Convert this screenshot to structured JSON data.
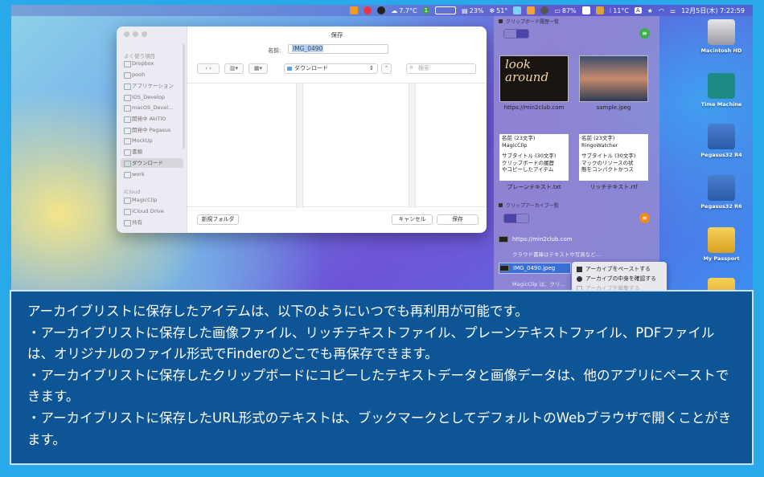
{
  "menubar": {
    "weather": "7.7°C",
    "badge_number": "1",
    "cpu_percent": "23%",
    "fan": "51°",
    "battery": "87%",
    "temp": "11°C",
    "input_mode": "A",
    "clock": "12月5日(木) 7:22:59"
  },
  "dialog": {
    "title": "保存",
    "name_label": "名前:",
    "name_value": "IMG_0490",
    "location": "ダウンロード",
    "search_placeholder": "検索",
    "new_folder": "新規フォルダ",
    "cancel": "キャンセル",
    "save": "保存",
    "sidebar": {
      "favorites_title": "よく使う項目",
      "favorites": [
        "Dropbox",
        "pooh",
        "アプリケーション",
        "iOS_Develop",
        "macOS_Devel...",
        "開発中 AkiTiO",
        "開発中 Pegasus",
        "MockUp",
        "書類",
        "ダウンロード",
        "work"
      ],
      "icloud_title": "iCloud",
      "icloud": [
        "MagicClip",
        "iCloud Drive",
        "共有"
      ]
    }
  },
  "panel": {
    "history_title": "クリップボード履歴一覧",
    "items": [
      {
        "caption": "https://min2club.com",
        "thumb_text": "look around"
      },
      {
        "caption": "sample.jpeg"
      }
    ],
    "text_cards": [
      {
        "caption": "プレーンテキスト.txt",
        "lines": [
          "名前 (23文字)",
          "MagicClip",
          "",
          "サブタイトル (30文字)",
          "クリップボードの履歴",
          "やコピーしたアイテム"
        ]
      },
      {
        "caption": "リッチテキスト.rtf",
        "lines": [
          "名前 (23文字)",
          "RingoWatcher",
          "",
          "サブタイトル (30文字)",
          "マックのリソースの状",
          "態をコンパクトかつス"
        ]
      }
    ],
    "archive_title": "クリップアーカイブ一覧",
    "archive_rows": [
      {
        "label": "https://min2club.com",
        "sub": false
      },
      {
        "label": "クラウド書庫はテキストや写真など...",
        "sub": true
      },
      {
        "label": "IMG_0490.jpeg",
        "sub": false,
        "selected": true
      },
      {
        "label": "MagicClip は、クリ...",
        "sub": true
      }
    ],
    "context_menu": [
      "アーカイブをペーストする",
      "アーカイブの中身を確認する",
      "アーカイブを編集する"
    ]
  },
  "desktop_icons": [
    "Macintosh HD",
    "Time Machine",
    "Pegasus32 R4",
    "Pegasus32 R6",
    "My Passport"
  ],
  "caption": {
    "lines": [
      "アーカイブリストに保存したアイテムは、以下のようにいつでも再利用が可能です。",
      "・アーカイブリストに保存した画像ファイル、リッチテキストファイル、プレーンテキストファイル、PDFファイルは、オリジナルのファイル形式でFinderのどこでも再保存できます。",
      "・アーカイブリストに保存したクリップボードにコピーしたテキストデータと画像データは、他のアプリにペーストできます。",
      "・アーカイブリストに保存したURL形式のテキストは、ブックマークとしてデフォルトのWebブラウザで開くことがきます。"
    ]
  },
  "colors": {
    "frame": "#29a9ea",
    "caption_bg": "#0e5595",
    "selection": "#3b6fd6",
    "panel": "#968cd2"
  }
}
